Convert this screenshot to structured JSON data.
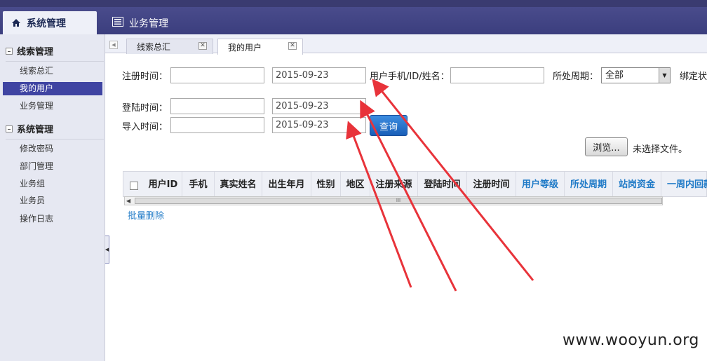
{
  "header": {
    "tabs": [
      {
        "label": "系统管理",
        "icon": "home-icon",
        "active": true
      },
      {
        "label": "业务管理",
        "icon": "list-icon",
        "active": false
      }
    ]
  },
  "sidebar": {
    "groups": [
      {
        "label": "线索管理",
        "items": [
          {
            "label": "线索总汇",
            "active": false
          },
          {
            "label": "我的用户",
            "active": true
          },
          {
            "label": "业务管理",
            "active": false
          }
        ]
      },
      {
        "label": "系统管理",
        "items": [
          {
            "label": "修改密码",
            "active": false
          },
          {
            "label": "部门管理",
            "active": false
          },
          {
            "label": "业务组",
            "active": false
          },
          {
            "label": "业务员",
            "active": false
          },
          {
            "label": "操作日志",
            "active": false
          }
        ]
      }
    ]
  },
  "content_tabs": [
    {
      "label": "线索总汇",
      "active": false
    },
    {
      "label": "我的用户",
      "active": true
    }
  ],
  "form": {
    "reg_time_label": "注册时间：",
    "reg_time_from": "",
    "reg_time_to": "2015-09-23",
    "user_search_label": "用户手机/ID/姓名：",
    "user_search_value": "",
    "period_label": "所处周期：",
    "period_value": "全部",
    "bind_label": "绑定状",
    "login_time_label": "登陆时间：",
    "login_time_from": "",
    "login_time_to": "2015-09-23",
    "import_time_label": "导入时间：",
    "import_time_from": "",
    "import_time_to": "2015-09-23",
    "query_button": "查询",
    "browse_button": "浏览...",
    "file_status": "未选择文件。"
  },
  "table": {
    "columns": [
      {
        "label": "用户ID",
        "link": false
      },
      {
        "label": "手机",
        "link": false
      },
      {
        "label": "真实姓名",
        "link": false
      },
      {
        "label": "出生年月",
        "link": false
      },
      {
        "label": "性别",
        "link": false
      },
      {
        "label": "地区",
        "link": false
      },
      {
        "label": "注册来源",
        "link": false
      },
      {
        "label": "登陆时间",
        "link": false
      },
      {
        "label": "注册时间",
        "link": false
      },
      {
        "label": "用户等级",
        "link": true
      },
      {
        "label": "所处周期",
        "link": true
      },
      {
        "label": "站岗资金",
        "link": true
      },
      {
        "label": "一周内回款",
        "link": true
      }
    ],
    "scroll_thumb_glyph": "III",
    "batch_delete": "批量删除"
  },
  "colors": {
    "header_bg": "#3b3e7e",
    "sidebar_active": "#3f44a2",
    "link": "#1f7ac7",
    "annotation_arrow": "#e8333a"
  },
  "watermark": "www.wooyun.org"
}
